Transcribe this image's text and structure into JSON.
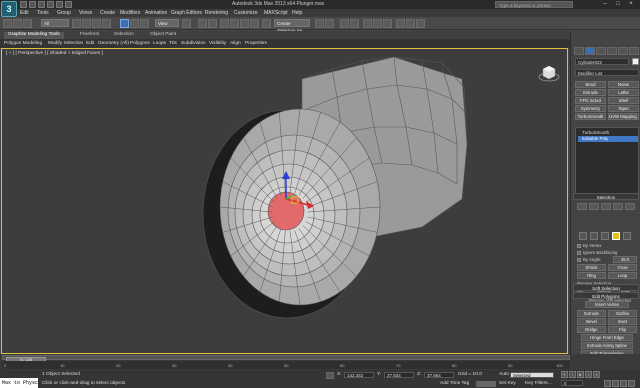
{
  "window": {
    "title": "Autodesk 3ds Max 2013 x64    Plunger.max",
    "search_placeholder": "Type a keyword or phrase",
    "logo": "3"
  },
  "menu": [
    "Edit",
    "Tools",
    "Group",
    "Views",
    "Create",
    "Modifiers",
    "Animation",
    "Graph Editors",
    "Rendering",
    "Customize",
    "MAXScript",
    "Help"
  ],
  "toolbar": {
    "filter_dropdown": "All",
    "view_dropdown": "View",
    "selection_set_dropdown": "Create Selection Se"
  },
  "ribbon": {
    "tabs": [
      "Graphite Modeling Tools",
      "Freeform",
      "Selection",
      "Object Paint"
    ],
    "commands": [
      "Polygon Modeling",
      "Modify Selection",
      "Edit",
      "Geometry (All)",
      "Polygons",
      "Loops",
      "Tris",
      "Subdivision",
      "Visibility",
      "Align",
      "Properties"
    ]
  },
  "viewport": {
    "label": "[ + ] [ Perspective ] [ Shaded + Edged Faces ]",
    "selection_color": "#e26a6a"
  },
  "command_panel": {
    "object_name": "Cylinder022",
    "modifier_list": "Modifier List",
    "buttons": [
      [
        "Bend",
        "Noise"
      ],
      [
        "Extrude",
        "Lathe"
      ],
      [
        "FFD 3x3x3",
        "Shell"
      ],
      [
        "Symmetry",
        "Taper"
      ],
      [
        "TurboSmooth",
        "UVW Mapping Cl"
      ]
    ],
    "stack": [
      "TurboSmooth",
      "Editable Poly"
    ],
    "selection": {
      "title": "Selection",
      "by_vertex": "By Vertex",
      "ignore_backfacing": "Ignore Backfacing",
      "by_angle": "By Angle:",
      "angle_value": "45.0",
      "shrink": "Shrink",
      "grow": "Grow",
      "ring": "Ring",
      "loop": "Loop",
      "preview_selection": "Preview Selection",
      "off": "Off",
      "subobj": "SubObj",
      "multi": "Multi",
      "status": "Polygon 109 Selected"
    },
    "soft_selection": "Soft Selection",
    "edit_polygons": {
      "title": "Edit Polygons",
      "insert_vertex": "Insert Vertex",
      "extrude": "Extrude",
      "outline": "Outline",
      "bevel": "Bevel",
      "inset": "Inset",
      "bridge": "Bridge",
      "flip": "Flip",
      "hinge": "Hinge From Edge",
      "extrude_spline": "Extrude Along Spline",
      "edit_triangulation": "Edit Triangulation",
      "retriangulate": "Retriangulate",
      "turn": "Turn"
    }
  },
  "timeline": {
    "frame": "0 / 100",
    "ticks": [
      "0",
      "10",
      "20",
      "30",
      "40",
      "50",
      "60",
      "70",
      "80",
      "90",
      "100"
    ]
  },
  "status": {
    "listener": "Max to Physc",
    "selected": "1 Object Selected",
    "prompt": "Click or click-and-drag to select objects",
    "x": "142.342",
    "y": "27.834",
    "z": "37.964",
    "grid": "Grid = 10.0",
    "auto_key": "Auto Key",
    "selected_dropdown": "Selected",
    "set_key": "Set Key",
    "key_filters": "Key Filters...",
    "add_time_tag": "Add Time Tag",
    "frame_value": "0"
  }
}
